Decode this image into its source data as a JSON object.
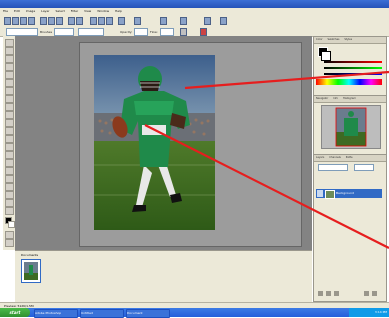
{
  "app": {
    "title_bar_color": "#2552b8"
  },
  "menubar": {
    "items": [
      "File",
      "Edit",
      "Image",
      "Layer",
      "Select",
      "Filter",
      "View",
      "Window",
      "Help"
    ]
  },
  "toolbar": {
    "labels": [
      "Brushes",
      "Opacity:",
      "Flow:"
    ]
  },
  "panels": {
    "color_tabs": [
      "Color",
      "Swatches",
      "Styles"
    ],
    "navigator_tabs": [
      "Navigator",
      "Info",
      "Histogram"
    ],
    "layers_tabs": [
      "Layers",
      "Channels",
      "Paths"
    ],
    "layer_name": "Background"
  },
  "bottom_panel": {
    "title": "Documents"
  },
  "status": {
    "text": "Preview: 512K/1.5M"
  },
  "taskbar": {
    "start_label": "start",
    "buttons": [
      "Adobe Photoshop",
      "Untitled",
      "Document"
    ],
    "clock": "3:14 PM"
  },
  "colors": {
    "arrow": "#e61e1e",
    "jersey": "#1f8a4a",
    "workspace": "#838383"
  }
}
